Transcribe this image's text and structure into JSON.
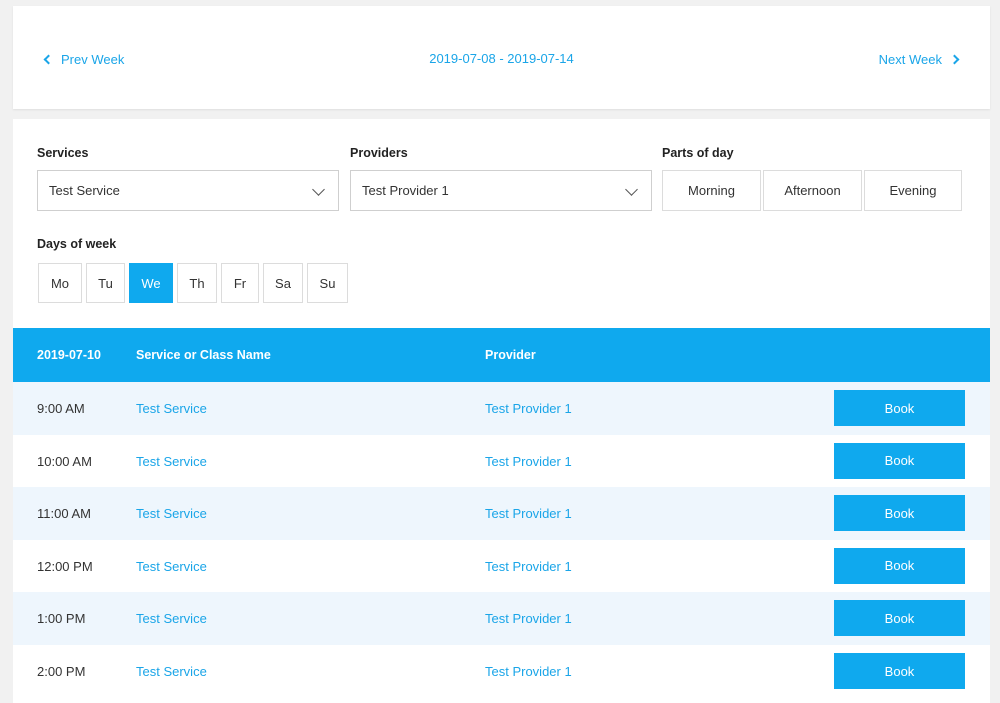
{
  "week_nav": {
    "prev_label": "Prev Week",
    "range": "2019-07-08 - 2019-07-14",
    "next_label": "Next Week"
  },
  "filters": {
    "services_label": "Services",
    "services_value": "Test Service",
    "providers_label": "Providers",
    "providers_value": "Test Provider 1",
    "parts_label": "Parts of day",
    "parts": [
      "Morning",
      "Afternoon",
      "Evening"
    ],
    "days_label": "Days of week",
    "days": [
      "Mo",
      "Tu",
      "We",
      "Th",
      "Fr",
      "Sa",
      "Su"
    ],
    "active_day": "We"
  },
  "table": {
    "headers": {
      "date": "2019-07-10",
      "service": "Service or Class Name",
      "provider": "Provider"
    },
    "rows": [
      {
        "time": "9:00 AM",
        "service": "Test Service",
        "provider": "Test Provider 1",
        "action": "Book"
      },
      {
        "time": "10:00 AM",
        "service": "Test Service",
        "provider": "Test Provider 1",
        "action": "Book"
      },
      {
        "time": "11:00 AM",
        "service": "Test Service",
        "provider": "Test Provider 1",
        "action": "Book"
      },
      {
        "time": "12:00 PM",
        "service": "Test Service",
        "provider": "Test Provider 1",
        "action": "Book"
      },
      {
        "time": "1:00 PM",
        "service": "Test Service",
        "provider": "Test Provider 1",
        "action": "Book"
      },
      {
        "time": "2:00 PM",
        "service": "Test Service",
        "provider": "Test Provider 1",
        "action": "Book"
      }
    ]
  },
  "colors": {
    "accent": "#0fa9ee",
    "link": "#1aa5e8",
    "row_alt": "#eef6fd"
  }
}
